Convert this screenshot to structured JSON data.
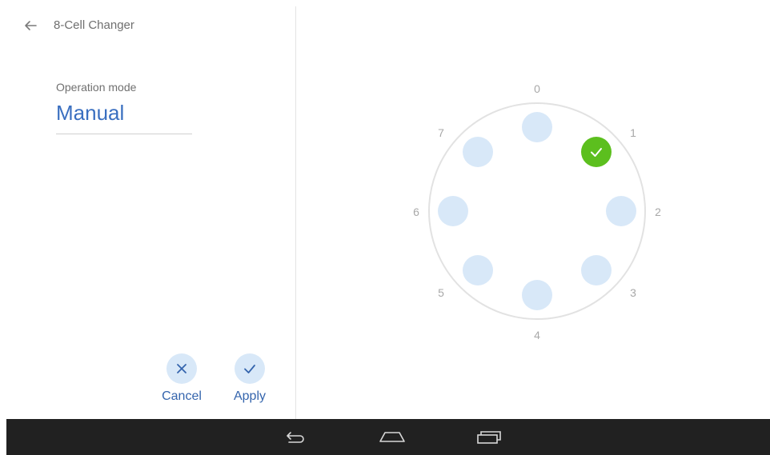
{
  "header": {
    "title": "8-Cell Changer",
    "back_icon": "arrow-left-icon"
  },
  "operation_mode": {
    "label": "Operation mode",
    "value": "Manual"
  },
  "actions": {
    "cancel_label": "Cancel",
    "apply_label": "Apply",
    "cancel_icon": "close-icon",
    "apply_icon": "check-icon"
  },
  "changer": {
    "positions": [
      "0",
      "1",
      "2",
      "3",
      "4",
      "5",
      "6",
      "7"
    ],
    "selected_position": "1",
    "selected_icon": "check-icon"
  },
  "colors": {
    "accent": "#3a6fc0",
    "cell_fill": "#d8e8f8",
    "selected_fill": "#5cbf1e",
    "nav_bar": "#212121"
  },
  "nav_bar": {
    "icons": [
      "back-icon",
      "home-icon",
      "recent-apps-icon"
    ]
  }
}
